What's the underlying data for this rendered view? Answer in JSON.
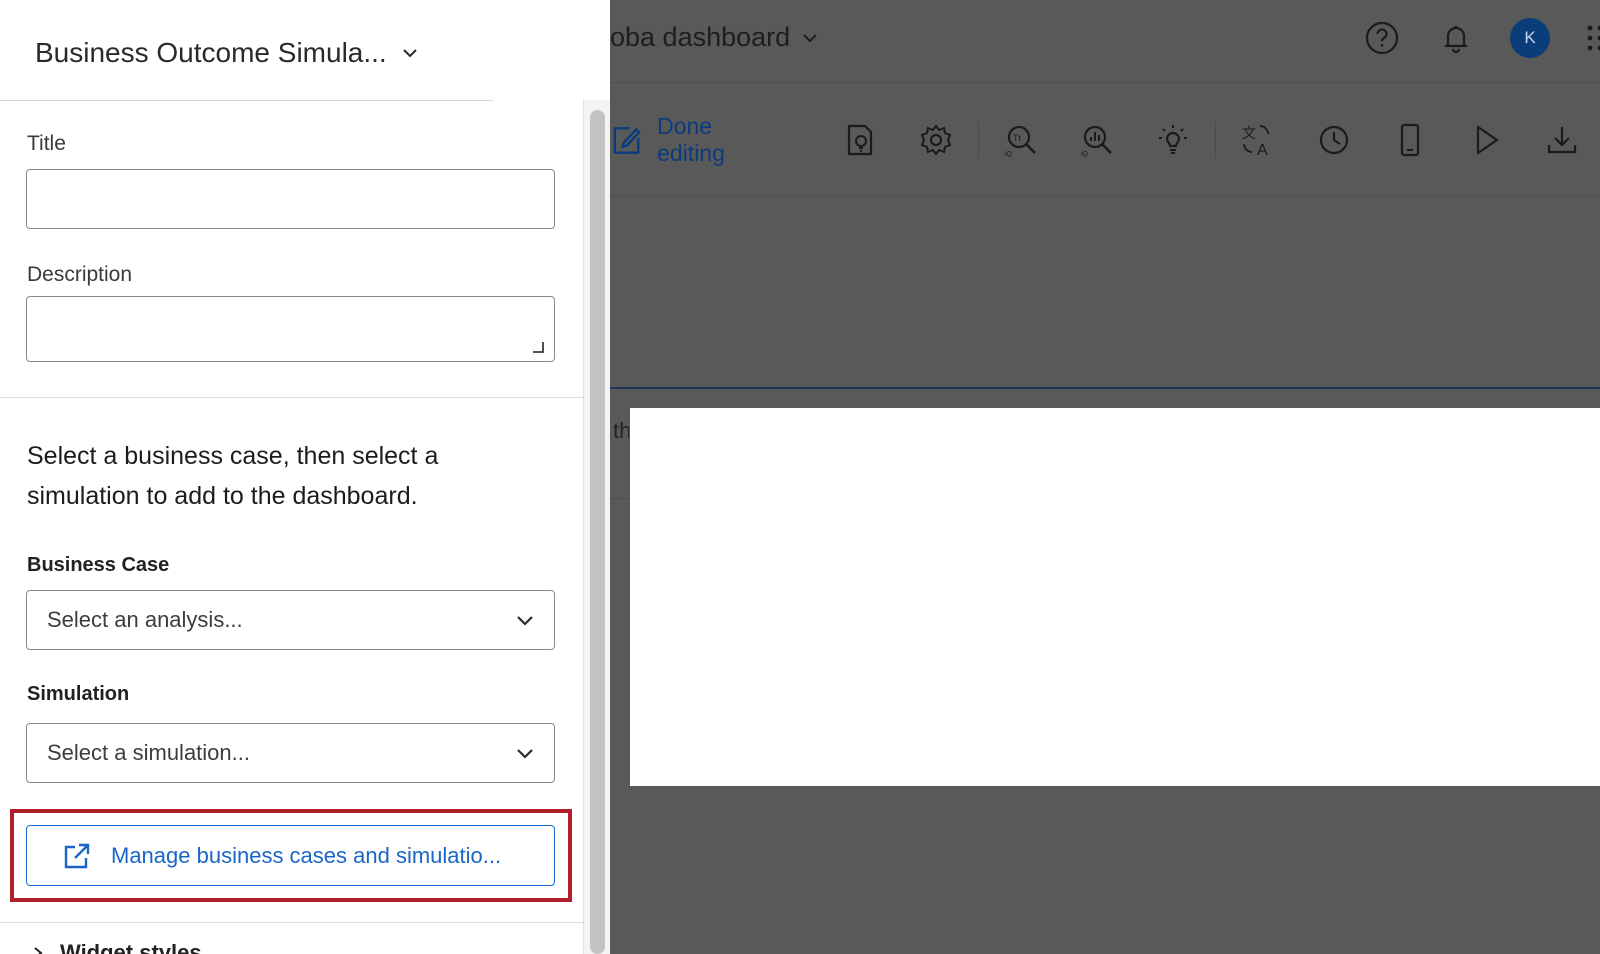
{
  "dashboard": {
    "title": "oba dashboard",
    "avatar_initial": "K",
    "done_editing_label": "Done editing",
    "truncated_text": "th"
  },
  "panel": {
    "header_title": "Business Outcome Simula...",
    "title_label": "Title",
    "title_value": "",
    "description_label": "Description",
    "description_value": "",
    "instructions": "Select a business case, then select a simulation to add to the dashboard.",
    "business_case_label": "Business Case",
    "business_case_placeholder": "Select an analysis...",
    "simulation_label": "Simulation",
    "simulation_placeholder": "Select a simulation...",
    "manage_button_label": "Manage business cases and simulatio...",
    "next_section_label": "Widget styles"
  },
  "colors": {
    "accent_blue": "#1a66c8",
    "highlight_red": "#b11f2d",
    "overlay": "#595959",
    "avatar_bg": "#0a3d7a"
  },
  "icons": {
    "top": [
      "help-icon",
      "bell-icon",
      "avatar",
      "app-grid-icon"
    ],
    "toolbar": [
      "edit-icon",
      "insight-page-icon",
      "settings-gear-icon",
      "text-analytics-icon",
      "stats-analytics-icon",
      "lightbulb-icon",
      "translate-icon",
      "history-clock-icon",
      "mobile-device-icon",
      "play-icon",
      "download-icon"
    ]
  }
}
